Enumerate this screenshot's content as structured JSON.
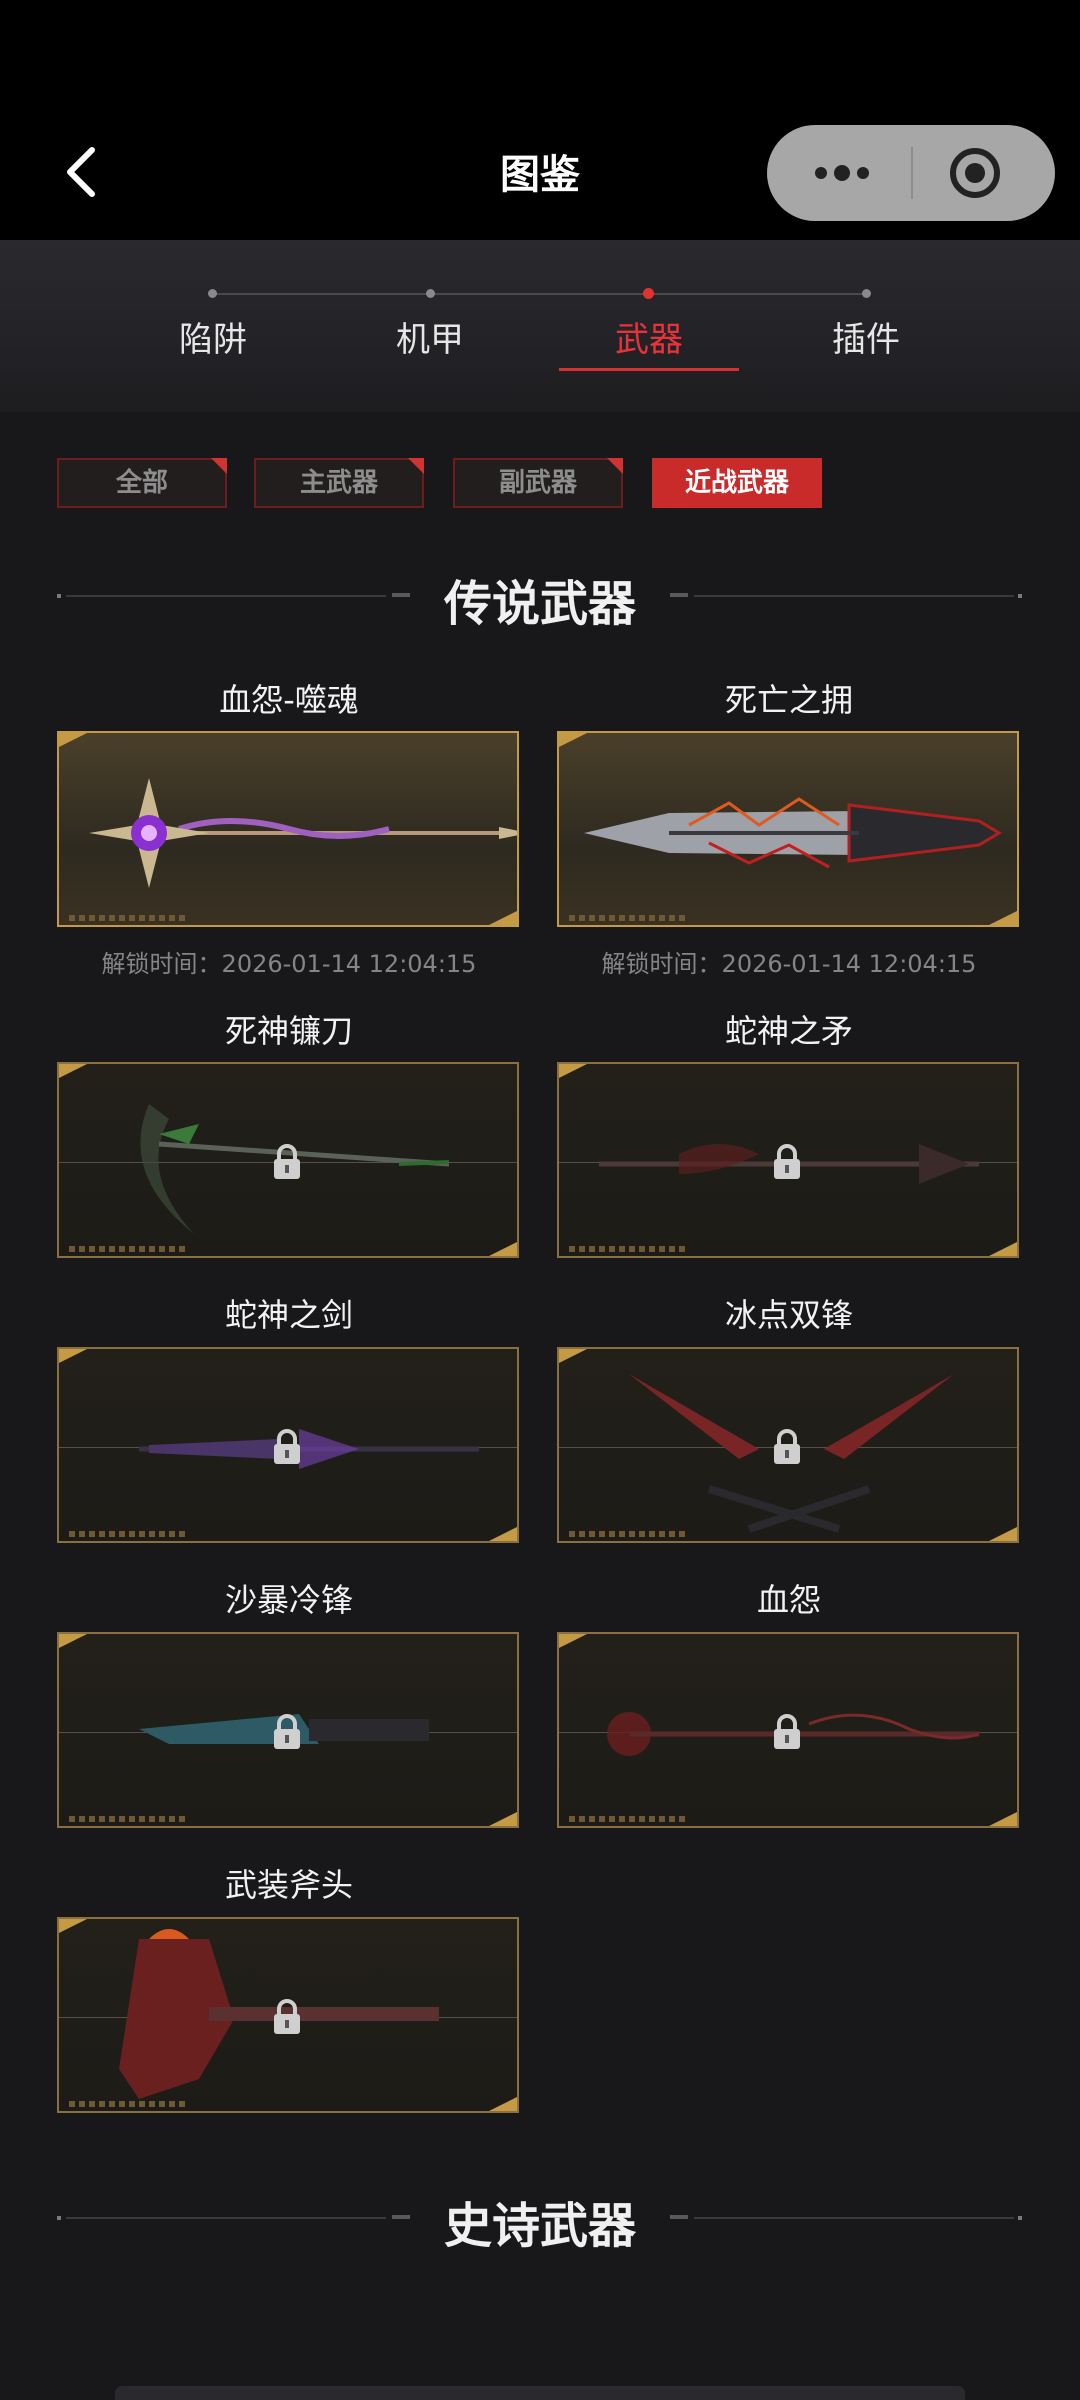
{
  "header": {
    "title": "图鉴"
  },
  "categories": [
    {
      "label": "陷阱",
      "active": false
    },
    {
      "label": "机甲",
      "active": false
    },
    {
      "label": "武器",
      "active": true
    },
    {
      "label": "插件",
      "active": false
    }
  ],
  "subtabs": [
    {
      "label": "全部",
      "active": false
    },
    {
      "label": "主武器",
      "active": false
    },
    {
      "label": "副武器",
      "active": false
    },
    {
      "label": "近战武器",
      "active": true
    }
  ],
  "sections": {
    "legendary": "传说武器",
    "epic": "史诗武器"
  },
  "items": [
    {
      "name": "血怨-噬魂",
      "unlocked": true,
      "unlock_time": "解锁时间：2026-01-14 12:04:15"
    },
    {
      "name": "死亡之拥",
      "unlocked": true,
      "unlock_time": "解锁时间：2026-01-14 12:04:15"
    },
    {
      "name": "死神镰刀",
      "unlocked": false
    },
    {
      "name": "蛇神之矛",
      "unlocked": false
    },
    {
      "name": "蛇神之剑",
      "unlocked": false
    },
    {
      "name": "冰点双锋",
      "unlocked": false
    },
    {
      "name": "沙暴冷锋",
      "unlocked": false
    },
    {
      "name": "血怨",
      "unlocked": false
    },
    {
      "name": "武装斧头",
      "unlocked": false
    }
  ],
  "icons": {
    "back": "chevron-left-icon",
    "more": "more-dots-icon",
    "close": "target-close-icon",
    "lock": "lock-icon"
  },
  "colors": {
    "accent": "#e0332f",
    "gold": "#c49a45"
  }
}
